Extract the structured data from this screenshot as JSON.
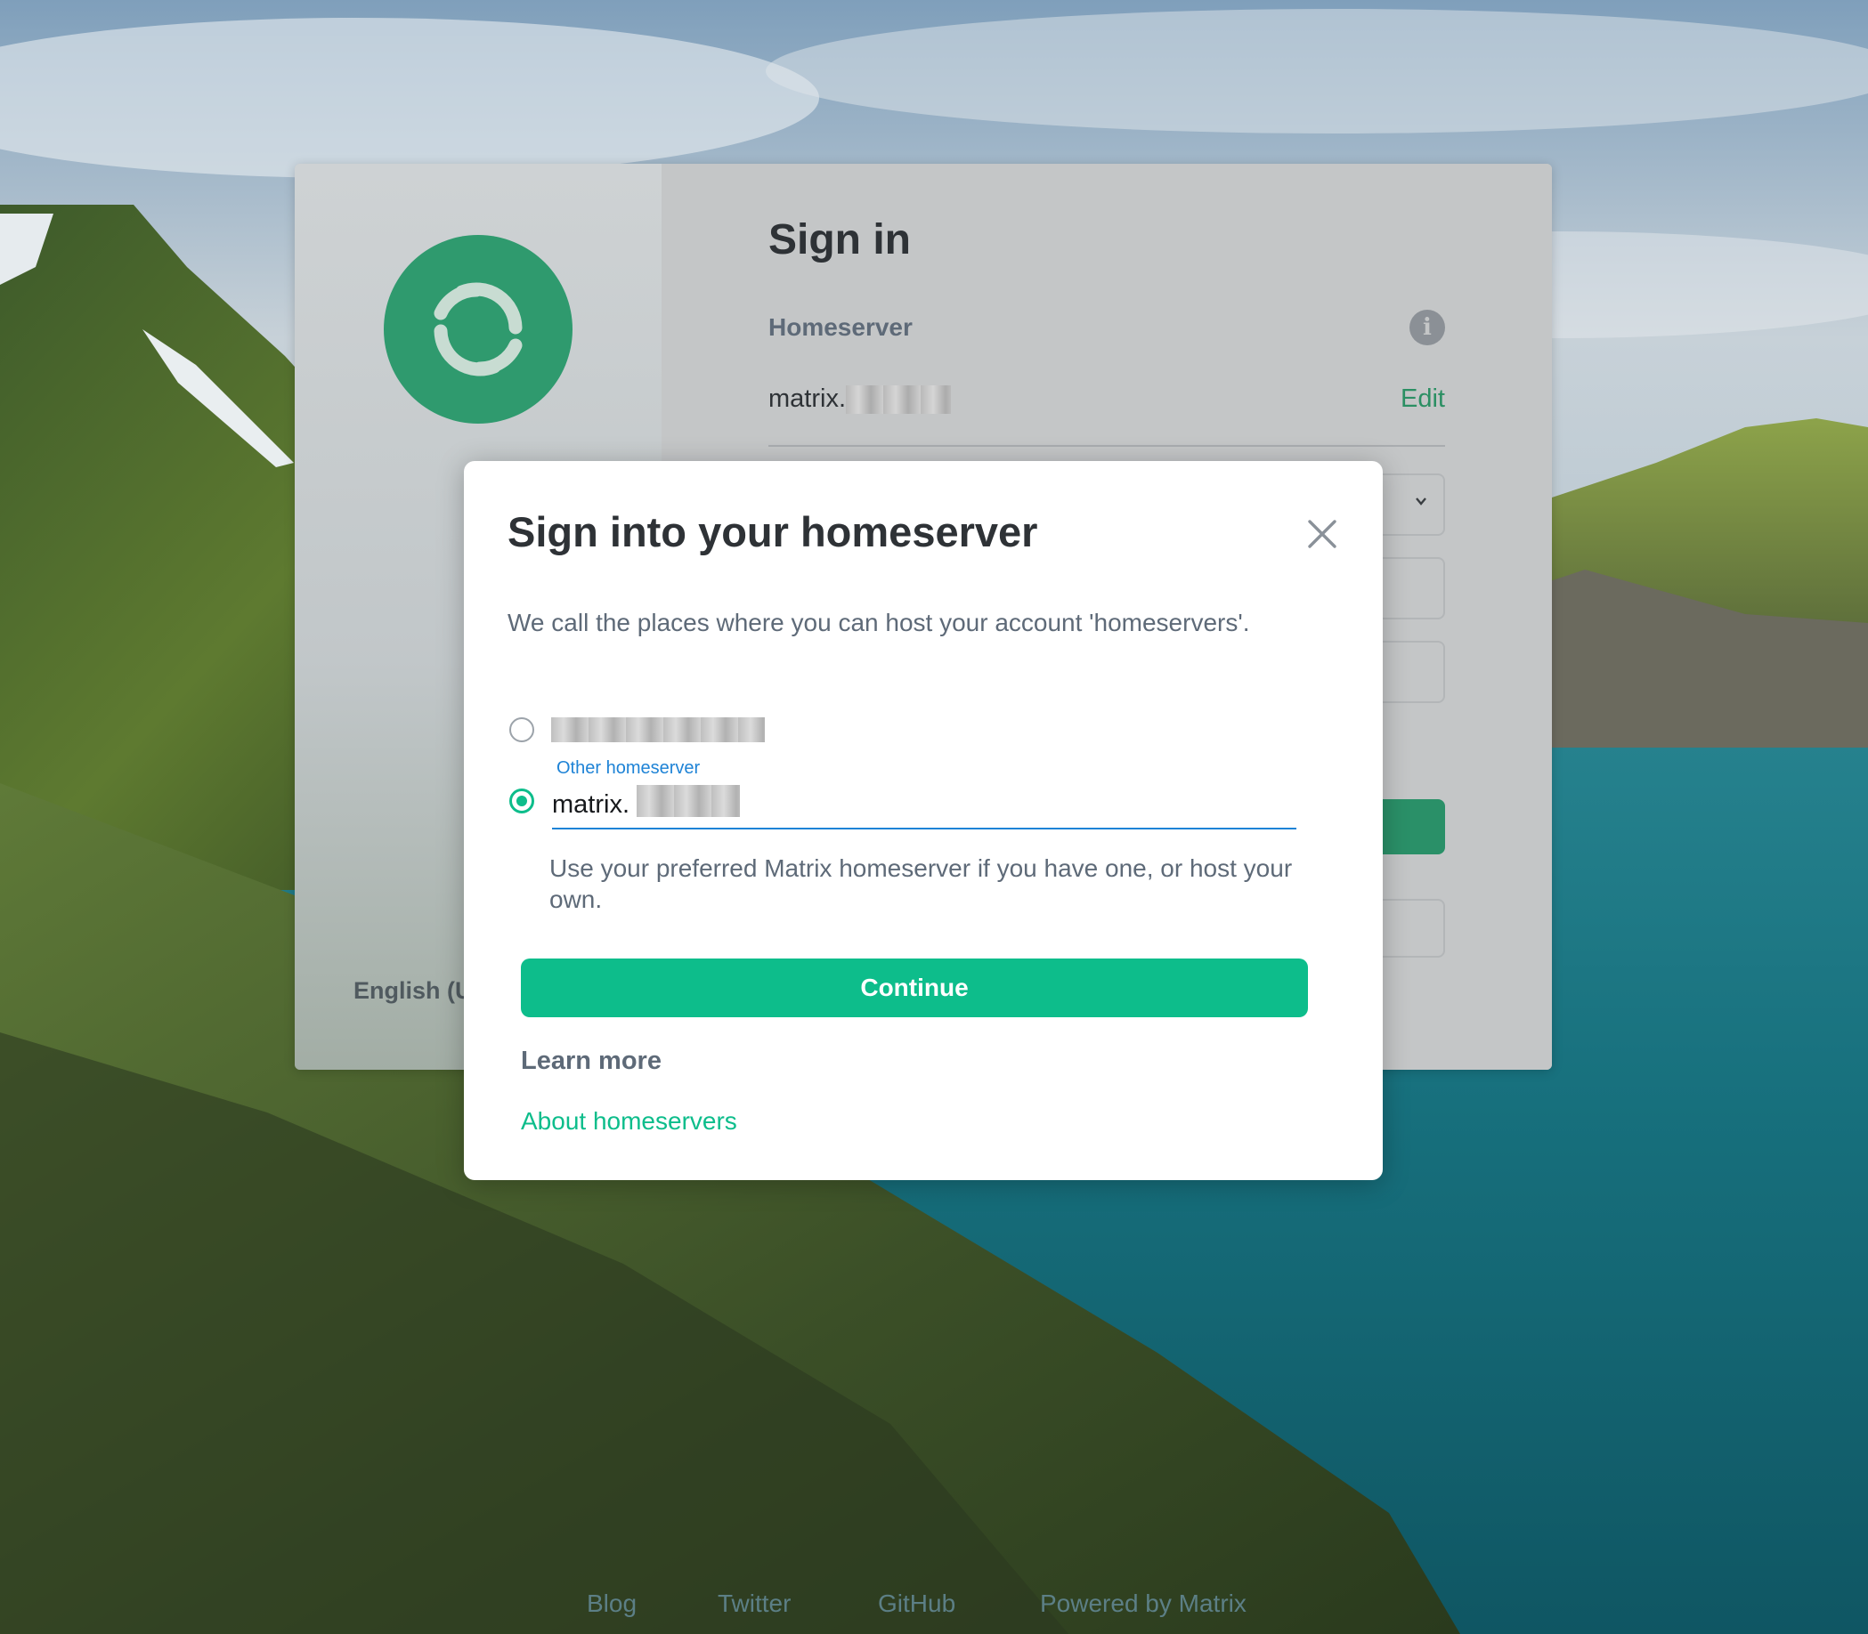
{
  "auth": {
    "title": "Sign in",
    "homeserver_label": "Homeserver",
    "homeserver_value_prefix": "matrix.",
    "edit_label": "Edit",
    "language": "English (U",
    "logo_icon": "element-logo-icon",
    "info_icon": "info-icon"
  },
  "modal": {
    "title": "Sign into your homeserver",
    "description": "We call the places where you can host your account 'homeservers'.",
    "other_homeserver_label": "Other homeserver",
    "input_value": "matrix.",
    "helper_text": "Use your preferred Matrix homeserver if you have one, or host your own.",
    "continue_label": "Continue",
    "learn_more_label": "Learn more",
    "about_link": "About homeservers",
    "close_icon": "close-icon",
    "selected_option": "other",
    "accent_color": "#0dbd8b",
    "focus_color": "#1e83d6"
  },
  "footer": {
    "links": [
      "Blog",
      "Twitter",
      "GitHub",
      "Powered by Matrix"
    ]
  }
}
